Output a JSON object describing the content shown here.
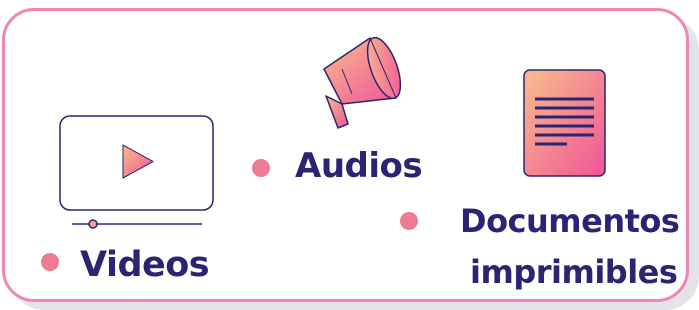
{
  "colors": {
    "border": "#ee86b6",
    "text": "#2a2573",
    "bullet": "#ec7b93",
    "gradient_start": "#f8be8c",
    "gradient_end": "#ef5497",
    "outline": "#2a2573"
  },
  "items": [
    {
      "label": "Videos",
      "icon": "video-player-icon"
    },
    {
      "label": "Audios",
      "icon": "megaphone-icon"
    },
    {
      "label_line1": "Documentos",
      "label_line2": "imprimibles",
      "icon": "document-icon"
    }
  ]
}
